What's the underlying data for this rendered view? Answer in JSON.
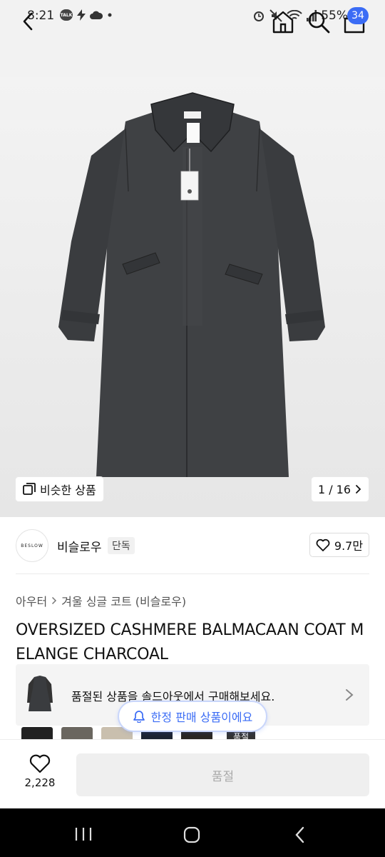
{
  "status_bar": {
    "time": "8:21",
    "battery": "55%",
    "talk_label": "TALK"
  },
  "header": {
    "cart_count": "34"
  },
  "gallery": {
    "similar_label": "비슷한 상품",
    "pager": "1 / 16",
    "coat_color": "#3a3c3f"
  },
  "brand": {
    "logo_text": "BESLOW",
    "name": "비슬로우",
    "exclusive_tag": "단독",
    "likes": "9.7만"
  },
  "breadcrumb": {
    "category": "아우터",
    "subcategory": "겨울 싱글 코트 (비슬로우)"
  },
  "product": {
    "title": "OVERSIZED CASHMERE BALMACAAN COAT MELANGE CHARCOAL"
  },
  "soldout_banner": {
    "text": "품절된 상품을 솔드아웃에서 구매해보세요."
  },
  "limited_notice": {
    "text": "한정 판매 상품이에요"
  },
  "option_thumbs": {
    "soldout_label": "품절"
  },
  "bottom_bar": {
    "wish_count": "2,228",
    "buy_label": "품절"
  },
  "colors": {
    "accent": "#3b6cf5",
    "disabled_bg": "#efefef"
  }
}
